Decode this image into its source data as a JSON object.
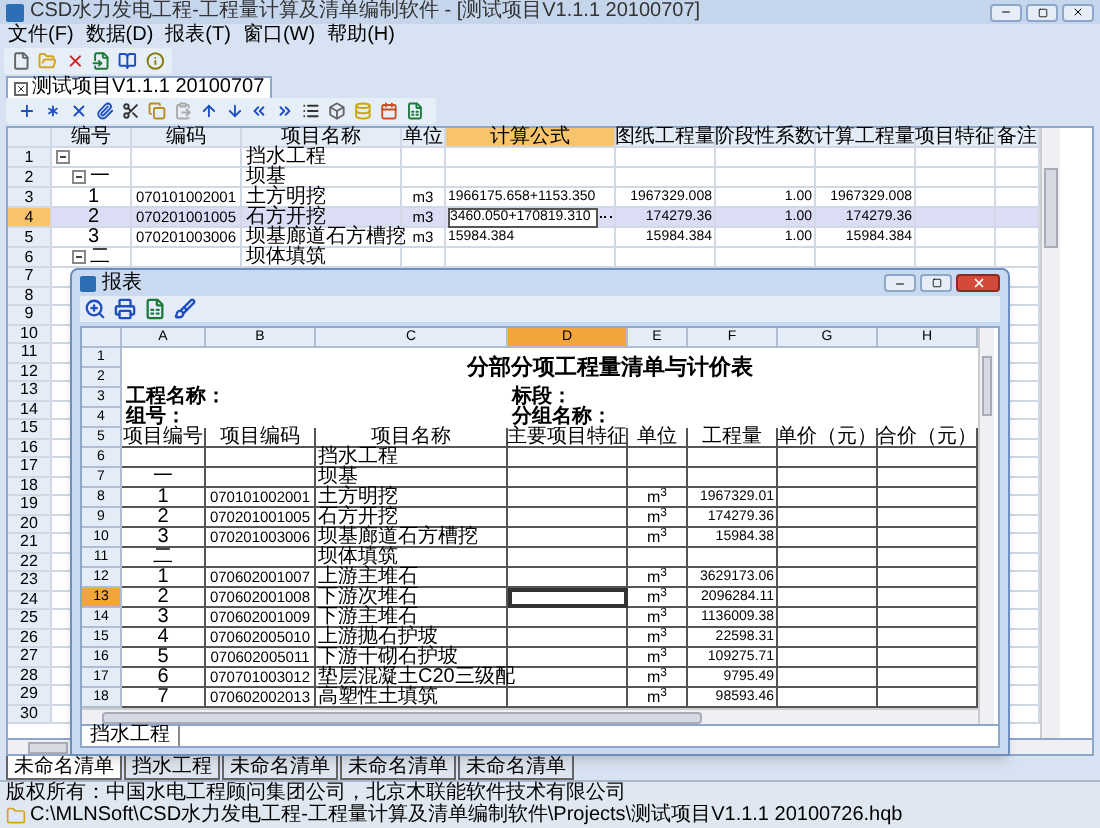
{
  "window": {
    "title": "CSD水力发电工程-工程量计算及清单编制软件 - [测试项目V1.1.1 20100707]"
  },
  "menu": [
    "文件(F)",
    "数据(D)",
    "报表(T)",
    "窗口(W)",
    "帮助(H)"
  ],
  "document_tab": {
    "label": "测试项目V1.1.1 20100707",
    "selected": true
  },
  "grid": {
    "columns": [
      {
        "label": "编号",
        "selected": false
      },
      {
        "label": "编码",
        "selected": false
      },
      {
        "label": "项目名称",
        "selected": false
      },
      {
        "label": "单位",
        "selected": false
      },
      {
        "label": "计算公式",
        "selected": true
      },
      {
        "label": "图纸工程量",
        "selected": false
      },
      {
        "label": "阶段性系数",
        "selected": false
      },
      {
        "label": "计算工程量",
        "selected": false
      },
      {
        "label": "项目特征",
        "selected": false
      },
      {
        "label": "备注",
        "selected": false
      }
    ],
    "rows": [
      {
        "row": "1",
        "name": "挡水工程",
        "expanded": true,
        "selected": false,
        "children": [
          {
            "row": "2",
            "number": "一",
            "name": "坝基",
            "expanded": true,
            "selected": false,
            "children": [
              {
                "row": "3",
                "number": "1",
                "code": "070101002001",
                "name": "土方明挖",
                "unit": "m3",
                "formula": "1966175.658+1153.350",
                "drawing_qty": "1967329.008",
                "factor": "1.00",
                "calc_qty": "1967329.008",
                "selected": false
              },
              {
                "row": "4",
                "number": "2",
                "code": "070201001005",
                "name": "石方开挖",
                "unit": "m3",
                "formula": "3460.050+170819.310",
                "drawing_qty": "174279.36",
                "factor": "1.00",
                "calc_qty": "174279.36",
                "selected": true
              },
              {
                "row": "5",
                "number": "3",
                "code": "070201003006",
                "name": "坝基廊道石方槽挖",
                "unit": "m3",
                "formula": "15984.384",
                "drawing_qty": "15984.384",
                "factor": "1.00",
                "calc_qty": "15984.384",
                "selected": false
              }
            ]
          },
          {
            "row": "6",
            "number": "二",
            "name": "坝体填筑",
            "expanded": true,
            "selected": false
          }
        ]
      }
    ],
    "blank_rows": [
      "7",
      "8",
      "9",
      "10",
      "11",
      "12",
      "13",
      "14",
      "15",
      "16",
      "17",
      "18",
      "19",
      "20",
      "21",
      "22",
      "23",
      "24",
      "25",
      "26",
      "27",
      "28",
      "29",
      "30"
    ]
  },
  "sheet_tabs": [
    {
      "label": "未命名清单",
      "selected": true
    },
    {
      "label": "挡水工程",
      "selected": false
    },
    {
      "label": "未命名清单",
      "selected": false
    },
    {
      "label": "未命名清单",
      "selected": false
    },
    {
      "label": "未命名清单",
      "selected": false
    }
  ],
  "report_window": {
    "title": "报表",
    "columns": [
      {
        "letter": "A",
        "selected": false
      },
      {
        "letter": "B",
        "selected": false
      },
      {
        "letter": "C",
        "selected": false
      },
      {
        "letter": "D",
        "selected": true
      },
      {
        "letter": "E",
        "selected": false
      },
      {
        "letter": "F",
        "selected": false
      },
      {
        "letter": "G",
        "selected": false
      },
      {
        "letter": "H",
        "selected": false
      }
    ],
    "rows": [
      {
        "kind": "title",
        "rows": [
          "1",
          "2"
        ],
        "text": "分部分项工程量清单与计价表"
      },
      {
        "kind": "info",
        "row": "3",
        "label_a": "工程名称：",
        "label_b": "标段："
      },
      {
        "kind": "info",
        "row": "4",
        "label_a": "组号：",
        "label_b": "分组名称："
      },
      {
        "kind": "header",
        "row": "5",
        "cells": [
          "项目编号",
          "项目编码",
          "项目名称",
          "主要项目特征",
          "单位",
          "工程量",
          "单价（元）",
          "合价（元）"
        ]
      },
      {
        "kind": "item",
        "row": "6",
        "name": "挡水工程",
        "selected": false
      },
      {
        "kind": "item",
        "row": "7",
        "no": "一",
        "name": "坝基",
        "selected": false
      },
      {
        "kind": "item",
        "row": "8",
        "no": "1",
        "code": "070101002001",
        "name": "土方明挖",
        "unit": "m$^{3}$",
        "qty": "1967329.01",
        "selected": false
      },
      {
        "kind": "item",
        "row": "9",
        "no": "2",
        "code": "070201001005",
        "name": "石方开挖",
        "unit": "m$^{3}$",
        "qty": "174279.36",
        "selected": false
      },
      {
        "kind": "item",
        "row": "10",
        "no": "3",
        "code": "070201003006",
        "name": "坝基廊道石方槽挖",
        "unit": "m$^{3}$",
        "qty": "15984.38",
        "selected": false
      },
      {
        "kind": "item",
        "row": "11",
        "no": "二",
        "name": "坝体填筑",
        "selected": false
      },
      {
        "kind": "item",
        "row": "12",
        "no": "1",
        "code": "070602001007",
        "name": "上游主堆石",
        "unit": "m$^{3}$",
        "qty": "3629173.06",
        "selected": false
      },
      {
        "kind": "item",
        "row": "13",
        "no": "2",
        "code": "070602001008",
        "name": "下游次堆石",
        "unit": "m$^{3}$",
        "qty": "2096284.11",
        "selected": true
      },
      {
        "kind": "item",
        "row": "14",
        "no": "3",
        "code": "070602001009",
        "name": "下游主堆石",
        "unit": "m$^{3}$",
        "qty": "1136009.38",
        "selected": false
      },
      {
        "kind": "item",
        "row": "15",
        "no": "4",
        "code": "070602005010",
        "name": "上游抛石护坡",
        "unit": "m$^{3}$",
        "qty": "22598.31",
        "selected": false
      },
      {
        "kind": "item",
        "row": "16",
        "no": "5",
        "code": "070602005011",
        "name": "下游干砌石护坡",
        "unit": "m$^{3}$",
        "qty": "109275.71",
        "selected": false
      },
      {
        "kind": "item",
        "row": "17",
        "no": "6",
        "code": "070701003012",
        "name": "垫层混凝土C20三级配",
        "unit": "m$^{3}$",
        "qty": "9795.49",
        "selected": false
      },
      {
        "kind": "item",
        "row": "18",
        "no": "7",
        "code": "070602002013",
        "name": "高塑性土填筑",
        "unit": "m$^{3}$",
        "qty": "98593.46",
        "selected": false
      }
    ],
    "sheet_tabs": [
      {
        "label": "挡水工程",
        "selected": true
      }
    ]
  },
  "status_bar": {
    "copyright": "版权所有：中国水电工程顾问集团公司，北京木联能软件技术有限公司",
    "path": "C:\\MLNSoft\\CSD水力发电工程-工程量计算及清单编制软件\\Projects\\测试项目V1.1.1 20100726.hqb"
  }
}
